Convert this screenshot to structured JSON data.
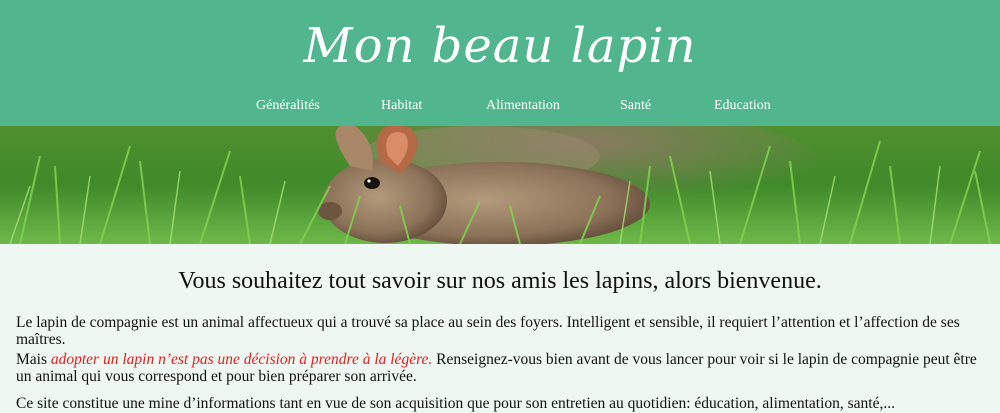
{
  "site": {
    "title": "Mon beau lapin"
  },
  "nav": {
    "items": [
      "Généralités",
      "Habitat",
      "Alimentation",
      "Santé",
      "Education"
    ]
  },
  "hero": {
    "icon": "rabbit-in-grass-photo"
  },
  "main": {
    "headline": "Vous souhaitez tout savoir sur nos amis les lapins, alors bienvenue.",
    "p1": "Le lapin de compagnie est un animal affectueux qui a trouvé sa place au sein des foyers. Intelligent et sensible, il requiert l’attention et l’affection de ses maîtres.",
    "p2_prefix": "Mais ",
    "p2_highlight": "adopter un lapin n’est pas une décision à prendre à la légère.",
    "p2_suffix": " Renseignez-vous bien avant de vous lancer pour voir si le lapin de compagnie peut être un animal qui vous correspond et pour bien préparer son arrivée.",
    "p3": "Ce site constitue une mine d’informations tant en vue de son acquisition que pour son entretien au quotidien: éducation, alimentation, santé,..."
  },
  "colors": {
    "header": "#51b68d",
    "highlight": "#e02020",
    "background": "#eef7f1"
  }
}
